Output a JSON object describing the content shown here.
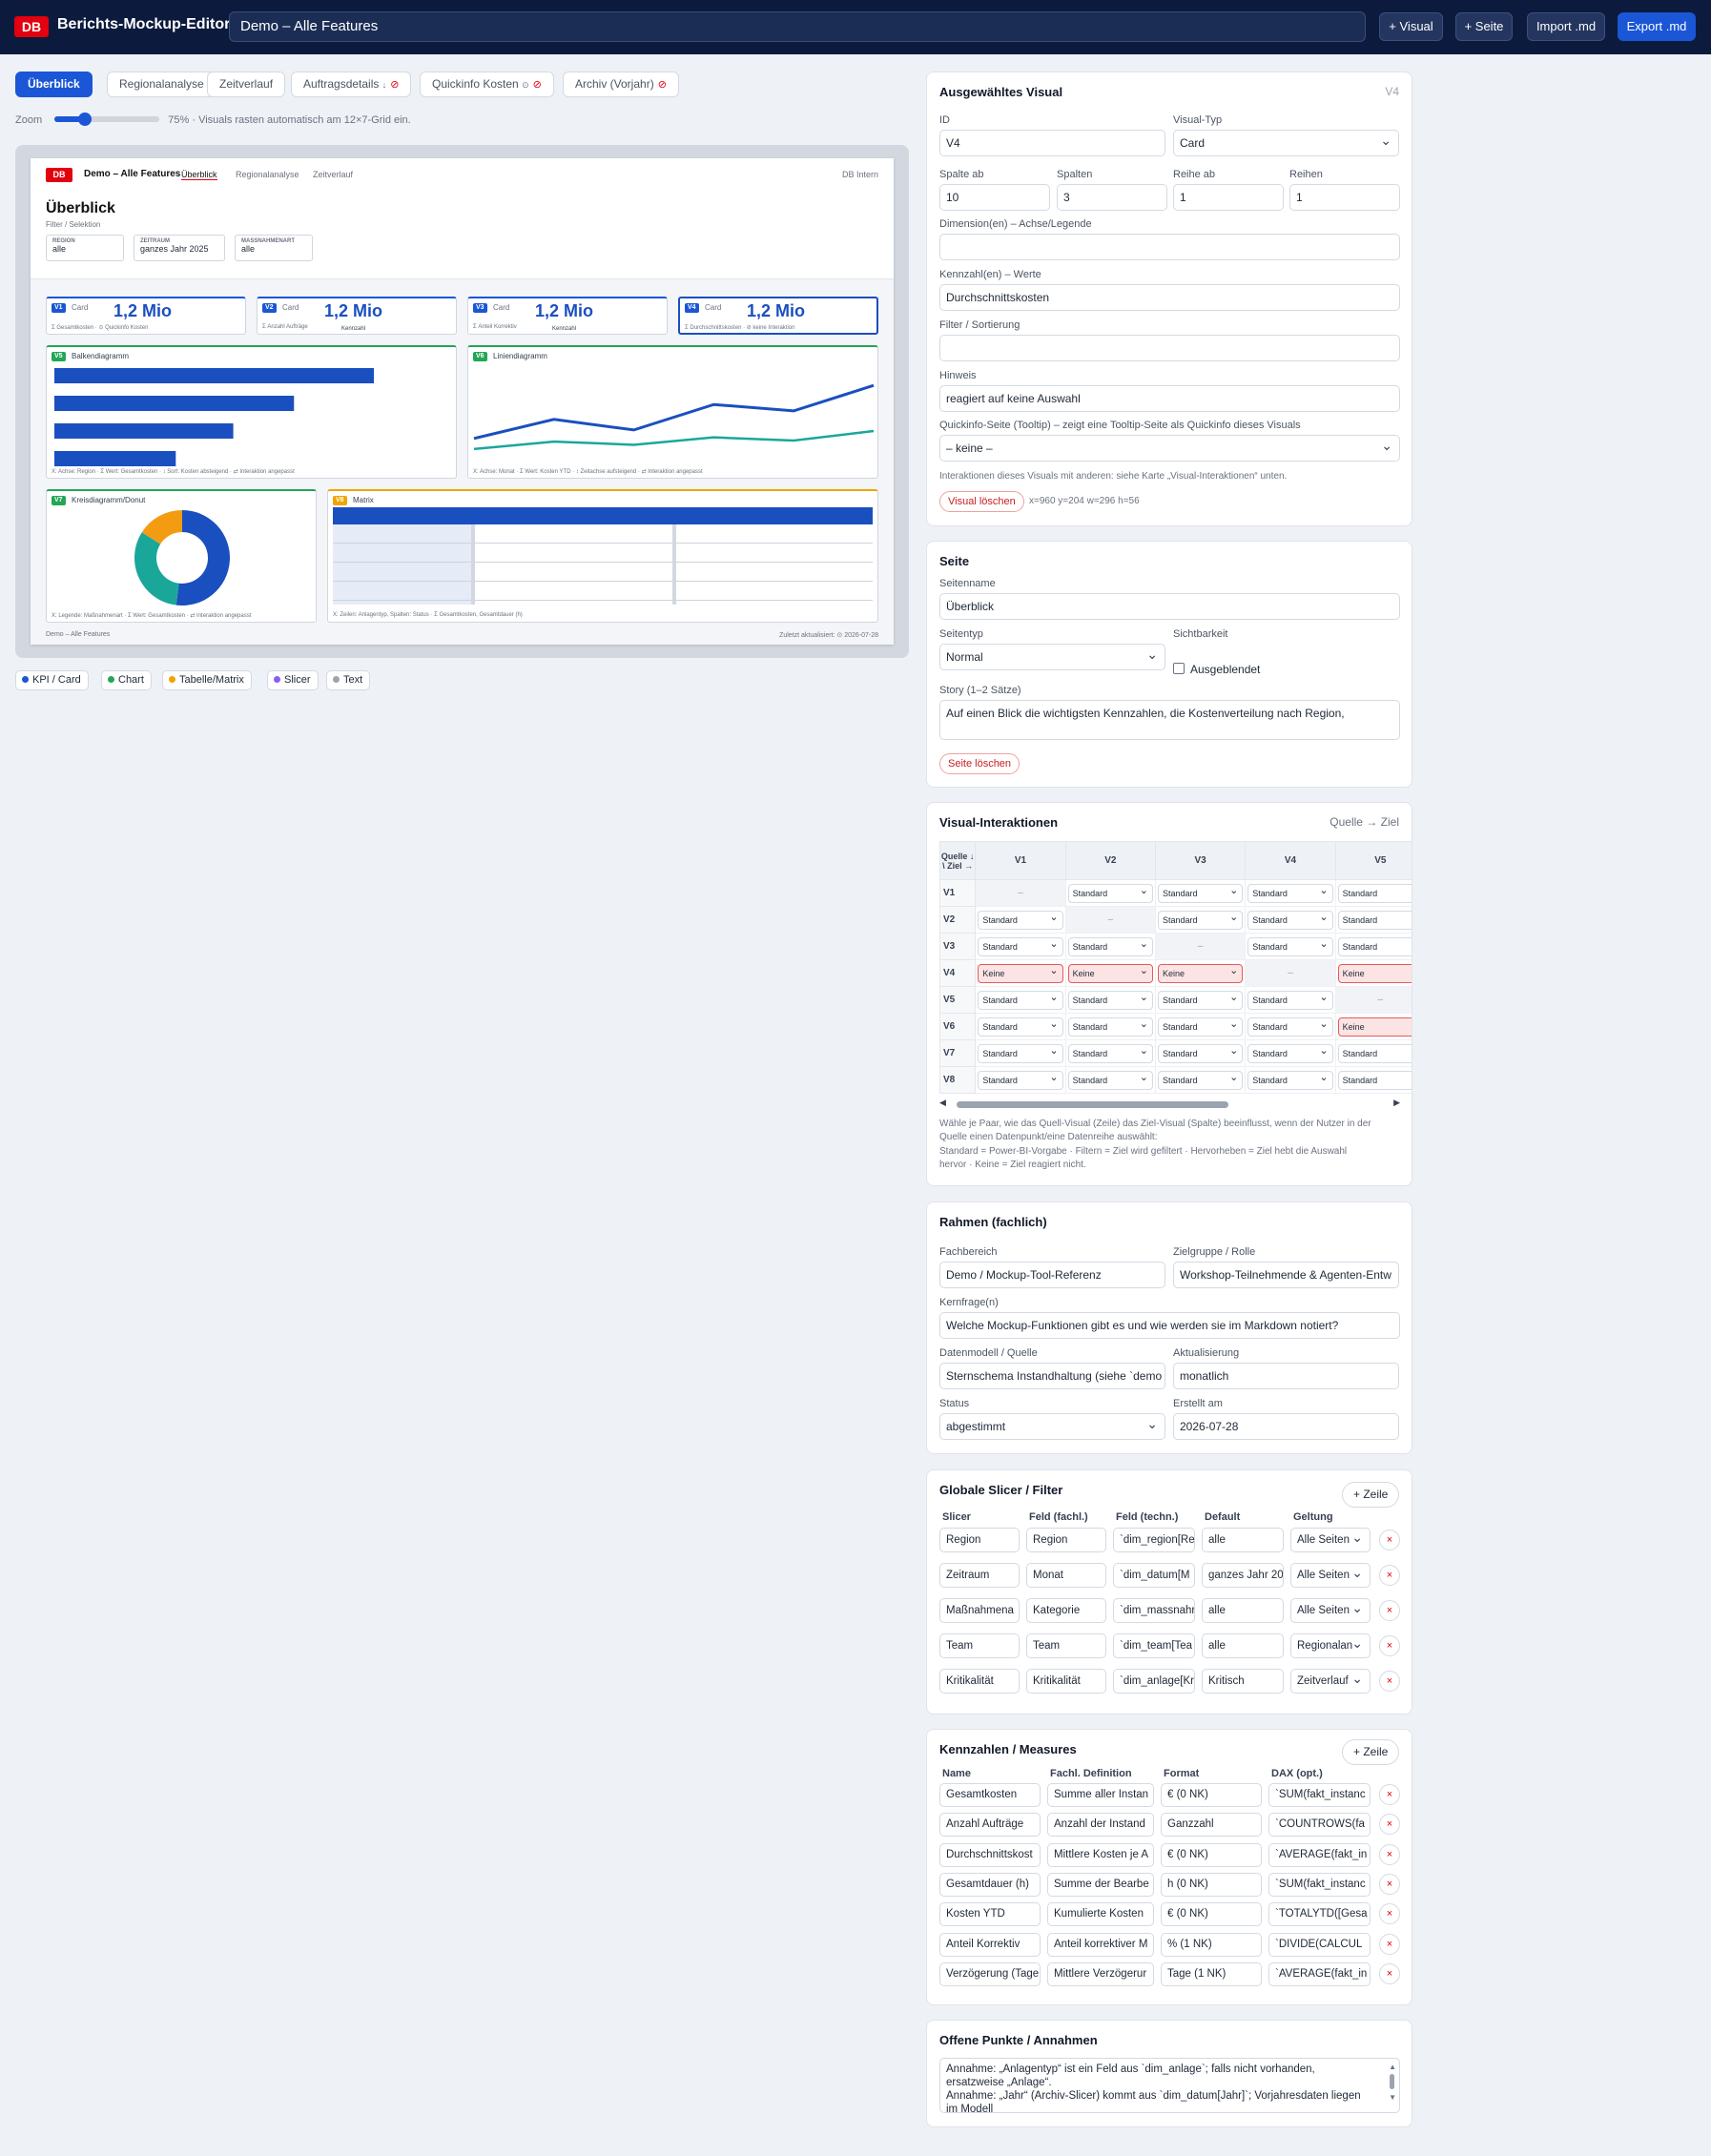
{
  "app": {
    "logo": "DB",
    "title": "Berichts-Mockup-Editor",
    "report_title": "Demo – Alle Features",
    "buttons": {
      "add_visual": "+ Visual",
      "add_page": "+ Seite",
      "import": "Import .md",
      "export": "Export .md"
    }
  },
  "tabs": [
    {
      "label": "Überblick",
      "hidden": false,
      "extra": ""
    },
    {
      "label": "Regionalanalyse",
      "hidden": false,
      "extra": ""
    },
    {
      "label": "Zeitverlauf",
      "hidden": false,
      "extra": ""
    },
    {
      "label": "Auftragsdetails",
      "hidden": true,
      "extra": "↓"
    },
    {
      "label": "Quickinfo Kosten",
      "hidden": true,
      "extra": "⊙"
    },
    {
      "label": "Archiv (Vorjahr)",
      "hidden": true,
      "extra": ""
    }
  ],
  "zoom": {
    "label": "Zoom",
    "value": 75,
    "value_text": "75%",
    "hint": "· Visuals rasten automatisch am 12×7-Grid ein."
  },
  "canvas": {
    "logo": "DB",
    "title": "Demo – Alle Features",
    "nav": [
      "Überblick",
      "Regionalanalyse",
      "Zeitverlauf"
    ],
    "badge": "DB Intern",
    "page_title": "Überblick",
    "subtitle": "Filter / Selektion",
    "slicers": [
      {
        "label": "REGION",
        "value": "alle"
      },
      {
        "label": "ZEITRAUM",
        "value": "ganzes Jahr 2025"
      },
      {
        "label": "MASSNAHMENART",
        "value": "alle"
      }
    ],
    "cards": [
      {
        "id": "V1",
        "type": "Card",
        "value": "1,2 Mio",
        "sub": "Σ Gesamtkosten · ⊙ Quickinfo Kosten",
        "caption": "Kennzahl"
      },
      {
        "id": "V2",
        "type": "Card",
        "value": "1,2 Mio",
        "sub": "Σ Anzahl Aufträge",
        "caption": "Kennzahl"
      },
      {
        "id": "V3",
        "type": "Card",
        "value": "1,2 Mio",
        "sub": "Σ Anteil Korrektiv",
        "caption": "Kennzahl"
      },
      {
        "id": "V4",
        "type": "Card",
        "value": "1,2 Mio",
        "sub": "Σ Durchschnittskosten · ⊘ keine Interaktion",
        "caption": "Kennzahl"
      }
    ],
    "bar": {
      "id": "V5",
      "title": "Balkendiagramm",
      "footer": "X: Achse: Region · Σ Wert: Gesamtkosten · ↕ Sort: Kosten absteigend · ⇄ Interaktion angepasst",
      "values": [
        100,
        75,
        56,
        38
      ]
    },
    "line": {
      "id": "V6",
      "title": "Liniendiagramm",
      "footer": "X: Achse: Monat · Σ Wert: Kosten YTD · ↕ Zeitachse aufsteigend · ⇄ Interaktion angepasst",
      "s1": [
        20,
        38,
        28,
        52,
        46,
        70
      ],
      "s2": [
        10,
        17,
        14,
        21,
        18,
        27
      ]
    },
    "donut": {
      "id": "V7",
      "title": "Kreisdiagramm/Donut",
      "footer": "X: Legende: Maßnahmenart · Σ Wert: Gesamtkosten · ⇄ Interaktion angepasst",
      "values": [
        52,
        32,
        16
      ],
      "colors": [
        "#1a4fbf",
        "#1aa79a",
        "#f39c12"
      ]
    },
    "matrix": {
      "id": "V8",
      "title": "Matrix",
      "footer": "X: Zeilen: Anlagentyp, Spalten: Status · Σ Gesamtkosten, Gesamtdauer (h)"
    },
    "footer_left": "Demo – Alle Features",
    "footer_right": "Zuletzt aktualisiert: ⊙ 2026-07-28"
  },
  "legend": [
    {
      "label": "KPI / Card",
      "color": "#1a56d6"
    },
    {
      "label": "Chart",
      "color": "#22a755"
    },
    {
      "label": "Tabelle/Matrix",
      "color": "#f0a500"
    },
    {
      "label": "Slicer",
      "color": "#8b5cf6"
    },
    {
      "label": "Text",
      "color": "#9ca3af"
    }
  ],
  "visual": {
    "title": "Ausgewähltes Visual",
    "tag": "V4",
    "id_label": "ID",
    "id": "V4",
    "type_label": "Visual-Typ",
    "type": "Card",
    "col_label": "Spalte ab",
    "col": "10",
    "span_label": "Spalten",
    "span": "3",
    "row_label": "Reihe ab",
    "row": "1",
    "rows_label": "Reihen",
    "rows": "1",
    "dim_label": "Dimension(en) – Achse/Legende",
    "dim": "",
    "measure_label": "Kennzahl(en) – Werte",
    "measure": "Durchschnittskosten",
    "filter_label": "Filter / Sortierung",
    "filter": "",
    "hint_label": "Hinweis",
    "hint": "reagiert auf keine Auswahl",
    "tooltip_label": "Quickinfo-Seite (Tooltip) – zeigt eine Tooltip-Seite als Quickinfo dieses Visuals",
    "tooltip": "– keine –",
    "interaction_note": "Interaktionen dieses Visuals mit anderen: siehe Karte „Visual-Interaktionen“ unten.",
    "delete": "Visual löschen",
    "pos": "x=960 y=204 w=296 h=56"
  },
  "seite": {
    "title": "Seite",
    "name_label": "Seitenname",
    "name": "Überblick",
    "type_label": "Seitentyp",
    "type": "Normal",
    "vis_label": "Sichtbarkeit",
    "hidden_label": "Ausgeblendet",
    "story_label": "Story (1–2 Sätze)",
    "story": "Auf einen Blick die wichtigsten Kennzahlen, die Kostenverteilung nach Region,",
    "delete": "Seite löschen"
  },
  "interactions": {
    "title": "Visual-Interaktionen",
    "dir": "Quelle → Ziel",
    "corner": "Quelle ↓ \\ Ziel →",
    "cols": [
      "V1",
      "V2",
      "V3",
      "V4",
      "V5"
    ],
    "rows": [
      {
        "id": "V1",
        "cells": [
          "–",
          "Standard",
          "Standard",
          "Standard",
          "Standard"
        ]
      },
      {
        "id": "V2",
        "cells": [
          "Standard",
          "–",
          "Standard",
          "Standard",
          "Standard"
        ]
      },
      {
        "id": "V3",
        "cells": [
          "Standard",
          "Standard",
          "–",
          "Standard",
          "Standard"
        ]
      },
      {
        "id": "V4",
        "cells": [
          "Keine",
          "Keine",
          "Keine",
          "–",
          "Keine"
        ]
      },
      {
        "id": "V5",
        "cells": [
          "Standard",
          "Standard",
          "Standard",
          "Standard",
          "–"
        ]
      },
      {
        "id": "V6",
        "cells": [
          "Standard",
          "Standard",
          "Standard",
          "Standard",
          "Keine"
        ]
      },
      {
        "id": "V7",
        "cells": [
          "Standard",
          "Standard",
          "Standard",
          "Standard",
          "Standard"
        ]
      },
      {
        "id": "V8",
        "cells": [
          "Standard",
          "Standard",
          "Standard",
          "Standard",
          "Standard"
        ]
      }
    ],
    "help1": "Wähle je Paar, wie das Quell-Visual (Zeile) das Ziel-Visual (Spalte) beeinflusst, wenn der Nutzer in der",
    "help2": "Quelle einen Datenpunkt/eine Datenreihe auswählt:",
    "help3": "Standard = Power-BI-Vorgabe · Filtern = Ziel wird gefiltert · Hervorheben = Ziel hebt die Auswahl",
    "help4": "hervor · Keine = Ziel reagiert nicht."
  },
  "rahmen": {
    "title": "Rahmen (fachlich)",
    "fach_label": "Fachbereich",
    "fach": "Demo / Mockup-Tool-Referenz",
    "ziel_label": "Zielgruppe / Rolle",
    "ziel": "Workshop-Teilnehmende & Agenten-Entw",
    "frage_label": "Kernfrage(n)",
    "frage": "Welche Mockup-Funktionen gibt es und wie werden sie im Markdown notiert?",
    "daten_label": "Datenmodell / Quelle",
    "daten": "Sternschema Instandhaltung (siehe `demo",
    "akt_label": "Aktualisierung",
    "akt": "monatlich",
    "status_label": "Status",
    "status": "abgestimmt",
    "erst_label": "Erstellt am",
    "erst": "2026-07-28"
  },
  "slicers": {
    "title": "Globale Slicer / Filter",
    "add": "+ Zeile",
    "headers": [
      "Slicer",
      "Feld (fachl.)",
      "Feld (techn.)",
      "Default",
      "Geltung"
    ],
    "rows": [
      [
        "Region",
        "Region",
        "`dim_region[Re",
        "alle",
        "Alle Seiten"
      ],
      [
        "Zeitraum",
        "Monat",
        "`dim_datum[M",
        "ganzes Jahr 20",
        "Alle Seiten"
      ],
      [
        "Maßnahmena",
        "Kategorie",
        "`dim_massnahr",
        "alle",
        "Alle Seiten"
      ],
      [
        "Team",
        "Team",
        "`dim_team[Tea",
        "alle",
        "Regionalan"
      ],
      [
        "Kritikalität",
        "Kritikalität",
        "`dim_anlage[Kr",
        "Kritisch",
        "Zeitverlauf"
      ]
    ]
  },
  "measures": {
    "title": "Kennzahlen / Measures",
    "add": "+ Zeile",
    "headers": [
      "Name",
      "Fachl. Definition",
      "Format",
      "DAX (opt.)"
    ],
    "rows": [
      [
        "Gesamtkosten",
        "Summe aller Instan",
        "€ (0 NK)",
        "`SUM(fakt_instanc"
      ],
      [
        "Anzahl Aufträge",
        "Anzahl der Instand",
        "Ganzzahl",
        "`COUNTROWS(fa"
      ],
      [
        "Durchschnittskost",
        "Mittlere Kosten je A",
        "€ (0 NK)",
        "`AVERAGE(fakt_in"
      ],
      [
        "Gesamtdauer (h)",
        "Summe der Bearbe",
        "h (0 NK)",
        "`SUM(fakt_instanc"
      ],
      [
        "Kosten YTD",
        "Kumulierte Kosten",
        "€ (0 NK)",
        "`TOTALYTD([Gesa"
      ],
      [
        "Anteil Korrektiv",
        "Anteil korrektiver M",
        "% (1 NK)",
        "`DIVIDE(CALCUL"
      ],
      [
        "Verzögerung (Tage",
        "Mittlere Verzögerur",
        "Tage (1 NK)",
        "`AVERAGE(fakt_in"
      ]
    ]
  },
  "offen": {
    "title": "Offene Punkte / Annahmen",
    "l1": "Annahme: „Anlagentyp“ ist ein Feld aus `dim_anlage`; falls nicht vorhanden,",
    "l2": "ersatzweise „Anlage“.",
    "l3": "Annahme: „Jahr“ (Archiv-Slicer) kommt aus `dim_datum[Jahr]`; Vorjahresdaten liegen",
    "l4": "im Modell"
  }
}
